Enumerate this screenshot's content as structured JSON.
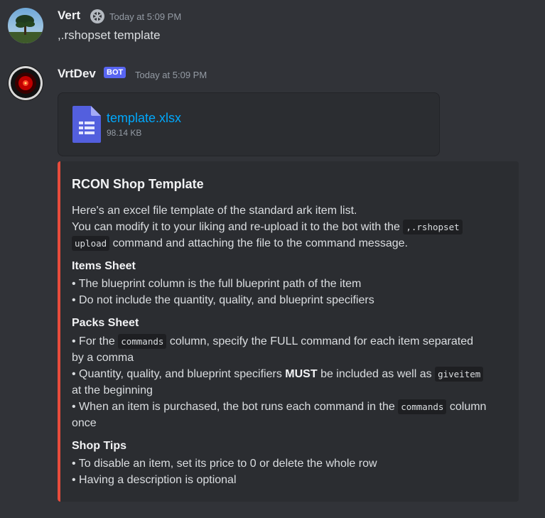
{
  "messages": [
    {
      "author": "Vert",
      "timestamp": "Today at 5:09 PM",
      "content": ",.rshopset template"
    },
    {
      "author": "VrtDev",
      "badge": "BOT",
      "timestamp": "Today at 5:09 PM",
      "attachment": {
        "name": "template.xlsx",
        "size": "98.14 KB"
      },
      "embed": {
        "title": "RCON Shop Template",
        "accent_color": "#e74c3c",
        "intro_1": "Here's an excel file template of the standard ark item list.",
        "intro_2a": "You can modify it to your liking and re-upload it to the bot with the",
        "intro_code_1": ",.rshopset",
        "intro_code_2": "upload",
        "intro_2b": "command and attaching the file to the command message.",
        "items_heading": "Items Sheet",
        "items_1": "• The blueprint column is the full blueprint path of the item",
        "items_2": "• Do not include the quantity, quality, and blueprint specifiers",
        "packs_heading": "Packs Sheet",
        "packs_1a": "• For the",
        "packs_code_commands": "commands",
        "packs_1b": "column, specify the FULL command for each item separated",
        "packs_1c": "by a comma",
        "packs_2a": "• Quantity, quality, and blueprint specifiers",
        "packs_2_bold": "MUST",
        "packs_2b": "be included as well as",
        "packs_code_giveitem": "giveitem",
        "packs_2c": "at the beginning",
        "packs_3a": "• When an item is purchased, the bot runs each command in the",
        "packs_3_code": "commands",
        "packs_3b": "column",
        "packs_3c": "once",
        "tips_heading": "Shop Tips",
        "tips_1": "• To disable an item, set its price to 0 or delete the whole row",
        "tips_2": "• Having a description is optional"
      }
    }
  ],
  "colors": {
    "background": "#313338",
    "embed_bg": "#2b2d31",
    "link": "#00a8fc",
    "bot_badge": "#5865f2"
  },
  "icons": {
    "file": "spreadsheet-file-icon",
    "role": "role-badge-icon"
  }
}
